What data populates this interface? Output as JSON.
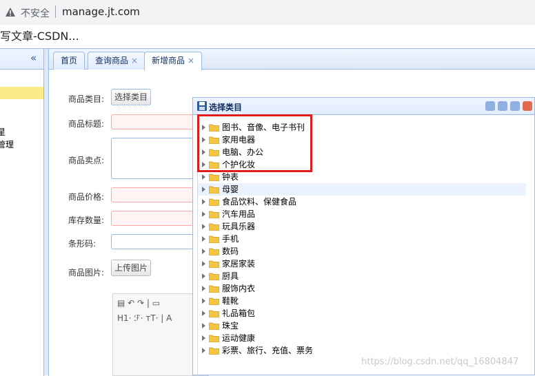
{
  "browser": {
    "insecure_label": "不安全",
    "url": "manage.jt.com",
    "tab_title": "写文章-CSDN..."
  },
  "sidebar": {
    "collapse_glyph": "«",
    "fragment_1": "星",
    "fragment_2": "管理"
  },
  "tabs": [
    {
      "label": "首页",
      "closable": false
    },
    {
      "label": "查询商品",
      "closable": true
    },
    {
      "label": "新增商品",
      "closable": true,
      "active": true
    }
  ],
  "close_glyph": "×",
  "form": {
    "category_label": "商品类目:",
    "category_button": "选择类目",
    "title_label": "商品标题:",
    "selling_point_label": "商品卖点:",
    "price_label": "商品价格:",
    "stock_label": "库存数量:",
    "barcode_label": "条形码:",
    "image_label": "商品图片:",
    "upload_button": "上传图片",
    "editor_row_1": "H1·  ℱ·  ᴛT·  |  A",
    "editor_row_0": "▤  ↶  ↷  |  ▭"
  },
  "dialog": {
    "title": "选择类目",
    "categories": [
      "图书、音像、电子书刊",
      "家用电器",
      "电脑、办公",
      "个护化妆",
      "钟表",
      "母婴",
      "食品饮料、保健食品",
      "汽车用品",
      "玩具乐器",
      "手机",
      "数码",
      "家居家装",
      "厨具",
      "服饰内衣",
      "鞋靴",
      "礼品箱包",
      "珠宝",
      "运动健康",
      "彩票、旅行、充值、票务"
    ],
    "hover_index": 5
  },
  "colors": {
    "highlight_box": "#e01b1b",
    "panel_border": "#99bbe8",
    "folder": "#f5c542"
  },
  "watermark": "https://blog.csdn.net/qq_16804847"
}
